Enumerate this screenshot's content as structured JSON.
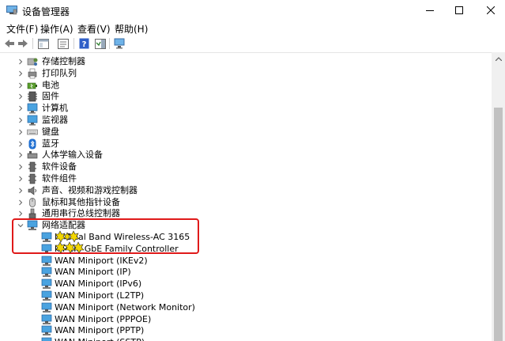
{
  "window": {
    "title": "设备管理器"
  },
  "menu": [
    {
      "label": "文件(F)"
    },
    {
      "label": "操作(A)"
    },
    {
      "label": "查看(V)"
    },
    {
      "label": "帮助(H)"
    }
  ],
  "tree": {
    "categories": [
      {
        "label": "存储控制器",
        "icon": "storage-controller-icon"
      },
      {
        "label": "打印队列",
        "icon": "printer-icon"
      },
      {
        "label": "电池",
        "icon": "battery-icon"
      },
      {
        "label": "固件",
        "icon": "firmware-icon"
      },
      {
        "label": "计算机",
        "icon": "computer-icon"
      },
      {
        "label": "监视器",
        "icon": "monitor-icon"
      },
      {
        "label": "键盘",
        "icon": "keyboard-icon"
      },
      {
        "label": "蓝牙",
        "icon": "bluetooth-icon"
      },
      {
        "label": "人体学输入设备",
        "icon": "hid-icon"
      },
      {
        "label": "软件设备",
        "icon": "software-device-icon"
      },
      {
        "label": "软件组件",
        "icon": "software-component-icon"
      },
      {
        "label": "声音、视频和游戏控制器",
        "icon": "sound-icon"
      },
      {
        "label": "鼠标和其他指针设备",
        "icon": "mouse-icon"
      },
      {
        "label": "通用串行总线控制器",
        "icon": "usb-icon"
      }
    ],
    "network": {
      "label": "网络适配器",
      "icon": "network-adapter-icon",
      "children": [
        {
          "label": "I        ) Dual Band Wireless-AC 3165"
        },
        {
          "label": "         k PCIe GbE Family Controller"
        },
        {
          "label": "WAN Miniport (IKEv2)"
        },
        {
          "label": "WAN Miniport (IP)"
        },
        {
          "label": "WAN Miniport (IPv6)"
        },
        {
          "label": "WAN Miniport (L2TP)"
        },
        {
          "label": "WAN Miniport (Network Monitor)"
        },
        {
          "label": "WAN Miniport (PPPOE)"
        },
        {
          "label": "WAN Miniport (PPTP)"
        },
        {
          "label": "WAN Miniport (SSTP)"
        }
      ]
    }
  },
  "colors": {
    "highlight": "#e01a1a",
    "redact": "#f2d600"
  }
}
